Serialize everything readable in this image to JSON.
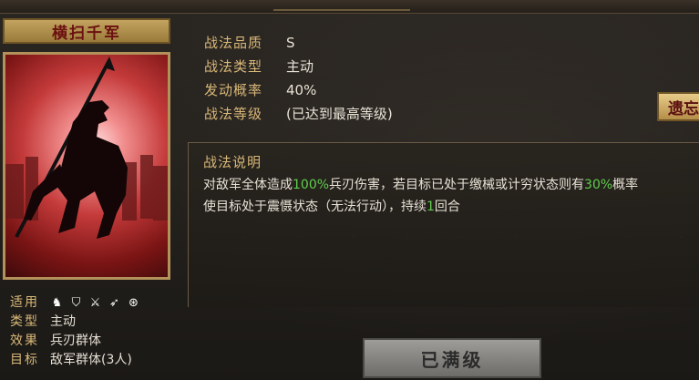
{
  "skill": {
    "name": "横扫千军",
    "units_label": "适用",
    "type_label": "类型",
    "type_value": "主动",
    "effect_label": "效果",
    "effect_value": "兵刃群体",
    "target_label": "目标",
    "target_value": "敌军群体(3人)",
    "unit_icons": [
      "cavalry-icon",
      "shield-icon",
      "crossed-swords-icon",
      "bow-icon",
      "wheel-icon"
    ]
  },
  "details": {
    "quality_label": "战法品质",
    "quality_value": "S",
    "type_label": "战法类型",
    "type_value": "主动",
    "chance_label": "发动概率",
    "chance_value": "40%",
    "level_label": "战法等级",
    "level_value": "(已达到最高等级)"
  },
  "description": {
    "title": "战法说明",
    "p1": "对敌军全体造成",
    "p2": "100%",
    "p3": "兵刃伤害，若目标已处于缴械或计穷状态则有",
    "p4": "30%",
    "p5": "概率",
    "p6": "使目标处于震慑状态（无法行动），持续",
    "p7": "1",
    "p8": "回合"
  },
  "buttons": {
    "side_tag": "遗忘",
    "max_level": "已满级"
  },
  "colors": {
    "highlight": "#5fce4d",
    "label_gold": "#d9b878",
    "title_red": "#6b1010"
  }
}
